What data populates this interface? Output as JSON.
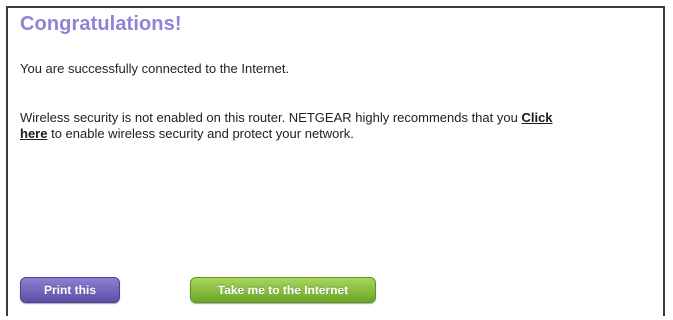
{
  "page": {
    "title": "Congratulations!",
    "connected_message": "You are successfully connected to the Internet.",
    "warning_before": "Wireless security is not enabled on this router. NETGEAR highly recommends that you ",
    "warning_link_1": "Click",
    "warning_link_2": "here",
    "warning_after": " to enable wireless security and protect your network."
  },
  "buttons": {
    "print_label": "Print this",
    "internet_label": "Take me to the Internet"
  },
  "colors": {
    "title": "#8e83d6",
    "print_button": "#6d60bb",
    "internet_button": "#86bf3f"
  }
}
